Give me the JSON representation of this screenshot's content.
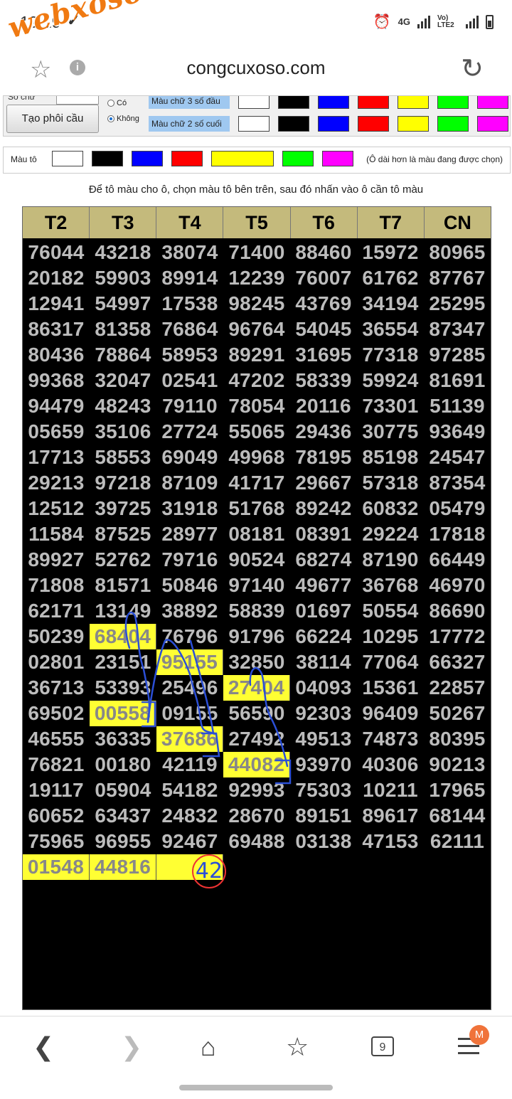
{
  "status_bar": {
    "time": "19:19",
    "net_label": "4G",
    "volte_label": "Vo) LTE2"
  },
  "watermark": "webxoso.net",
  "browser": {
    "url": "congcuxoso.com"
  },
  "panel": {
    "generate_button": "Tạo phôi cầu",
    "option_yes": "Có",
    "option_no": "Không",
    "row1_label": "Màu chữ 3 số đầu",
    "row2_label": "Màu chữ 2 số cuối",
    "swatches": [
      "#ffffff",
      "#000000",
      "#0000ff",
      "#ff0000",
      "#ffff00",
      "#00ff00",
      "#ff00ff"
    ]
  },
  "picker": {
    "label": "Màu tô",
    "note": "(Ô dài hơn là màu đang được chọn)",
    "swatches": [
      "#ffffff",
      "#000000",
      "#0000ff",
      "#ff0000",
      "#ffff00",
      "#00ff00",
      "#ff00ff"
    ],
    "selected": "#ffff00"
  },
  "hint": "Để tô màu cho ô, chọn màu tô bên trên, sau đó nhấn vào ô cần tô màu",
  "grid": {
    "headers": [
      "T2",
      "T3",
      "T4",
      "T5",
      "T6",
      "T7",
      "CN"
    ],
    "rows": [
      [
        "76044",
        "43218",
        "38074",
        "71400",
        "88460",
        "15972",
        "80965"
      ],
      [
        "20182",
        "59903",
        "89914",
        "12239",
        "76007",
        "61762",
        "87767"
      ],
      [
        "12941",
        "54997",
        "17538",
        "98245",
        "43769",
        "34194",
        "25295"
      ],
      [
        "86317",
        "81358",
        "76864",
        "96764",
        "54045",
        "36554",
        "87347"
      ],
      [
        "80436",
        "78864",
        "58953",
        "89291",
        "31695",
        "77318",
        "97285"
      ],
      [
        "99368",
        "32047",
        "02541",
        "47202",
        "58339",
        "59924",
        "81691"
      ],
      [
        "94479",
        "48243",
        "79110",
        "78054",
        "20116",
        "73301",
        "51139"
      ],
      [
        "05659",
        "35106",
        "27724",
        "55065",
        "29436",
        "30775",
        "93649"
      ],
      [
        "17713",
        "58553",
        "69049",
        "49968",
        "78195",
        "85198",
        "24547"
      ],
      [
        "29213",
        "97218",
        "87109",
        "41717",
        "29667",
        "57318",
        "87354"
      ],
      [
        "12512",
        "39725",
        "31918",
        "51768",
        "89242",
        "60832",
        "05479"
      ],
      [
        "11584",
        "87525",
        "28977",
        "08181",
        "08391",
        "29224",
        "17818"
      ],
      [
        "89927",
        "52762",
        "79716",
        "90524",
        "68274",
        "87190",
        "66449"
      ],
      [
        "71808",
        "81571",
        "50846",
        "97140",
        "49677",
        "36768",
        "46970"
      ],
      [
        "62171",
        "13149",
        "38892",
        "58839",
        "01697",
        "50554",
        "86690"
      ],
      [
        "50239",
        "68404",
        "76796",
        "91796",
        "66224",
        "10295",
        "17772"
      ],
      [
        "02801",
        "23151",
        "95155",
        "32850",
        "38114",
        "77064",
        "66327"
      ],
      [
        "36713",
        "53393",
        "25496",
        "27404",
        "04093",
        "15361",
        "22857"
      ],
      [
        "69502",
        "00558",
        "09155",
        "56590",
        "92303",
        "96409",
        "50267"
      ],
      [
        "46555",
        "36335",
        "37686",
        "27492",
        "49513",
        "74873",
        "80395"
      ],
      [
        "76821",
        "00180",
        "42119",
        "44082",
        "93970",
        "40306",
        "90213"
      ],
      [
        "19117",
        "05904",
        "54182",
        "92993",
        "75303",
        "10211",
        "17965"
      ],
      [
        "60652",
        "63437",
        "24832",
        "28670",
        "89151",
        "89617",
        "68144"
      ],
      [
        "75965",
        "96955",
        "92467",
        "69488",
        "03138",
        "47153",
        "62111"
      ],
      [
        "01548",
        "44816",
        "",
        "",
        "",
        "",
        ""
      ]
    ],
    "highlighted": [
      [
        15,
        1
      ],
      [
        16,
        2
      ],
      [
        17,
        3
      ],
      [
        18,
        1
      ],
      [
        19,
        2
      ],
      [
        20,
        3
      ],
      [
        24,
        0
      ],
      [
        24,
        1
      ],
      [
        24,
        2
      ]
    ],
    "annotation": "42"
  },
  "bottom_nav": {
    "tab_count": "9",
    "badge": "M"
  }
}
